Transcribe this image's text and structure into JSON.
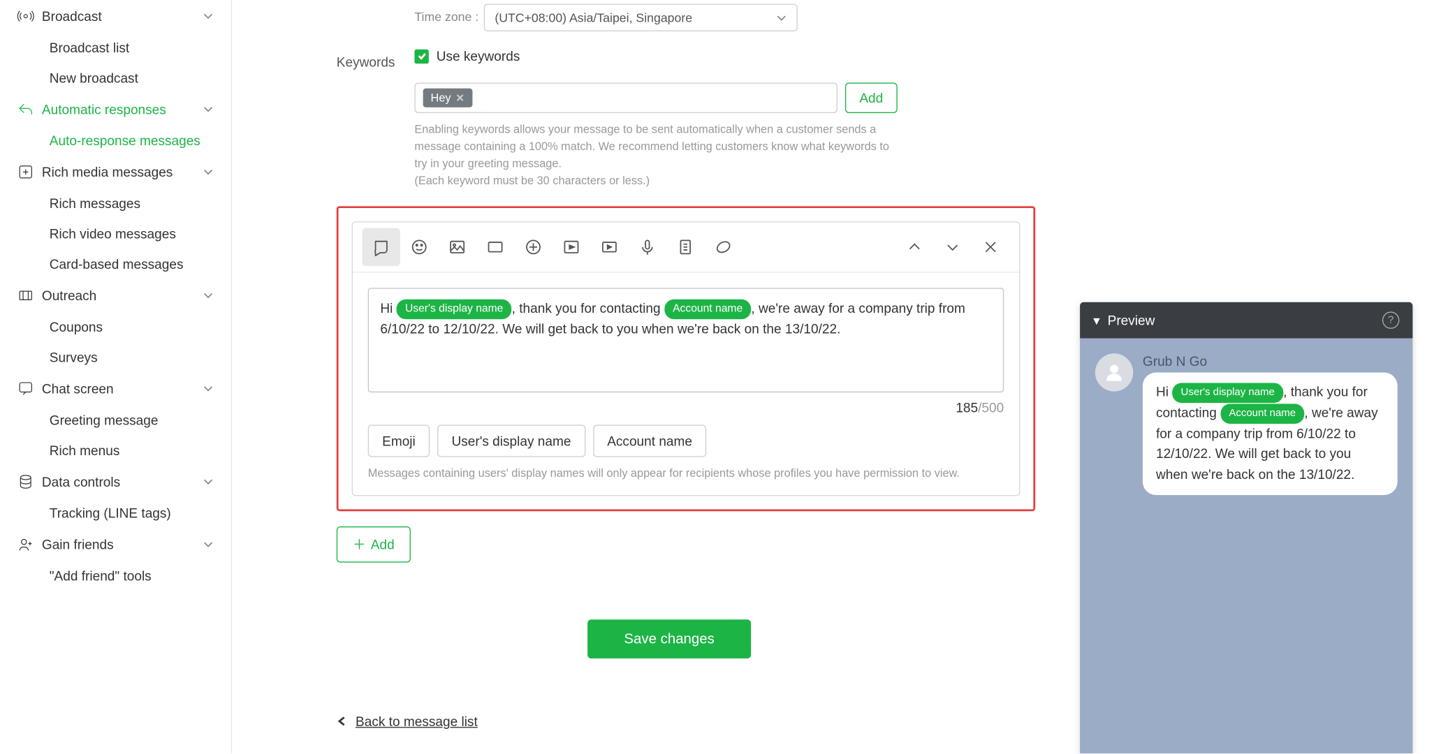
{
  "sidebar": {
    "broadcast": {
      "title": "Broadcast",
      "items": [
        "Broadcast list",
        "New broadcast"
      ]
    },
    "auto": {
      "title": "Automatic responses",
      "items": [
        "Auto-response messages"
      ]
    },
    "richmedia": {
      "title": "Rich media messages",
      "items": [
        "Rich messages",
        "Rich video messages",
        "Card-based messages"
      ]
    },
    "outreach": {
      "title": "Outreach",
      "items": [
        "Coupons",
        "Surveys"
      ]
    },
    "chat": {
      "title": "Chat screen",
      "items": [
        "Greeting message",
        "Rich menus"
      ]
    },
    "data": {
      "title": "Data controls",
      "items": [
        "Tracking (LINE tags)"
      ]
    },
    "gain": {
      "title": "Gain friends",
      "items": [
        "\"Add friend\" tools"
      ]
    }
  },
  "timezone": {
    "label": "Time zone :",
    "value": "(UTC+08:00) Asia/Taipei, Singapore"
  },
  "keywords": {
    "label": "Keywords",
    "checkbox_label": "Use keywords",
    "chip": "Hey",
    "add_btn": "Add",
    "help_line1": "Enabling keywords allows your message to be sent automatically when a customer sends a message containing a 100% match. We recommend letting customers know what keywords to try in your greeting message.",
    "help_line2": "(Each keyword must be 30 characters or less.)"
  },
  "editor": {
    "text_before_user": "Hi ",
    "user_pill": "User's display name",
    "text_between": ", thank you for contacting ",
    "account_pill": "Account name",
    "text_after": ", we're away for a company trip from 6/10/22 to 12/10/22. We will get back to you when we're back on the 13/10/22. ",
    "count": "185",
    "max": "/500",
    "insert_emoji": "Emoji",
    "insert_user": "User's display name",
    "insert_account": "Account name",
    "disclaimer": "Messages containing users' display names will only appear for recipients whose profiles you have permission to view."
  },
  "add_msg_btn": "Add",
  "save_btn": "Save changes",
  "back_link": "Back to message list",
  "preview": {
    "title": "Preview",
    "sender": "Grub N Go",
    "bubble_1": "Hi ",
    "user_pill": "User's display name",
    "bubble_2": ", thank you for contacting ",
    "account_pill": "Account name",
    "bubble_3": ", we're away for a company trip from 6/10/22 to 12/10/22. We will get back to you when we're back on the 13/10/22."
  }
}
